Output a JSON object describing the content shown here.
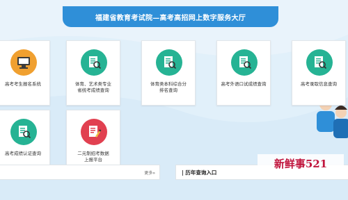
{
  "header": {
    "title": "福建省教育考试院—高考高招网上数字服务大厅"
  },
  "services": [
    {
      "label": "高考考生报名系统",
      "icon": "computer-icon",
      "color": "#f0a030"
    },
    {
      "label": "体育、艺术类专业\n省统考成绩查询",
      "icon": "document-search-icon",
      "color": "#26b394"
    },
    {
      "label": "体育类本科综合分\n排名查询",
      "icon": "document-search-icon",
      "color": "#26b394"
    },
    {
      "label": "高考外语口试成绩查询",
      "icon": "document-search-icon",
      "color": "#26b394"
    },
    {
      "label": "高考录取信息查询",
      "icon": "document-search-icon",
      "color": "#26b394"
    },
    {
      "label": "高考成绩认证查询",
      "icon": "document-search-icon",
      "color": "#26b394"
    },
    {
      "label": "二元制招考数据\n上报平台",
      "icon": "document-edit-icon",
      "color": "#e14050"
    }
  ],
  "bottom": {
    "left_more": "更多»",
    "right_title": "历年查询入口"
  },
  "watermark": "新鲜事521"
}
